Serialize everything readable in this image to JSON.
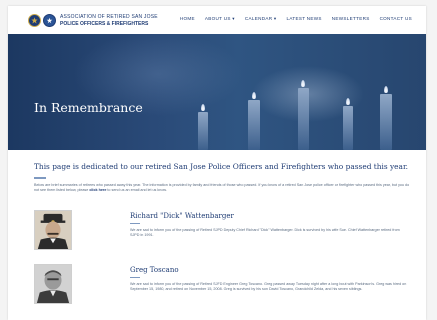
{
  "header": {
    "logo_line1": "ASSOCIATION OF RETIRED SAN JOSE",
    "logo_line2": "POLICE OFFICERS & FIREFIGHTERS",
    "nav": [
      {
        "label": "HOME"
      },
      {
        "label": "ABOUT US ▾"
      },
      {
        "label": "CALENDAR ▾"
      },
      {
        "label": "LATEST NEWS"
      },
      {
        "label": "NEWSLETTERS"
      },
      {
        "label": "CONTACT US"
      }
    ]
  },
  "hero": {
    "title": "In Remembrance"
  },
  "main": {
    "dedication": "This page is dedicated to our retired San Jose Police Officers and Firefighters who passed this year.",
    "intro_text": "Below are brief summaries of retirees who passed away this year. The information is provided by family and friends of those who passed. If you know of a retired San Jose police officer or firefighter who passed this year, but you do not see them listed below, please",
    "intro_link": "click here",
    "intro_tail": "to send us an email and let us know.",
    "members": [
      {
        "name": "Richard \"Dick\" Wattenbarger",
        "text": "We are sad to inform you of the passing of Retired SJPD Deputy Chief Richard \"Dick\" Wattenbarger. Dick is survived by his wife Sue. Chief Wattenbarger retired from SJPD in 1991."
      },
      {
        "name": "Greg Toscano",
        "text": "We are sad to inform you of the passing of Retired SJFD Engineer Greg Toscano. Greg passed away Tuesday night after a long bout with Parkinson's. Greg was hired on September 15, 1980, and retired on November 15, 2008. Greg is survived by his son David Toscano, Grandchild Zelda, and his seven siblings."
      }
    ]
  },
  "colors": {
    "brand_navy": "#1f3c74",
    "accent_blue": "#7e99c0",
    "body_text": "#5a6b80"
  }
}
